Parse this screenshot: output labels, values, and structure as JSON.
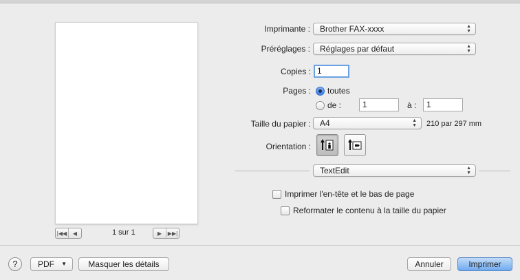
{
  "printer": {
    "label": "Imprimante :",
    "value": "Brother FAX-xxxx"
  },
  "presets": {
    "label": "Préréglages :",
    "value": "Réglages par défaut"
  },
  "copies": {
    "label": "Copies :",
    "value": "1"
  },
  "pages": {
    "label": "Pages :",
    "all_label": "toutes",
    "all_selected": true,
    "from_label": "de :",
    "from_value": "1",
    "to_label": "à :",
    "to_value": "1"
  },
  "paper_size": {
    "label": "Taille du papier :",
    "value": "A4",
    "dimensions": "210 par 297 mm"
  },
  "orientation": {
    "label": "Orientation :",
    "selected": "portrait",
    "icons": [
      "portrait-orientation-icon",
      "landscape-orientation-icon"
    ]
  },
  "app_section": {
    "value": "TextEdit"
  },
  "options": [
    {
      "label": "Imprimer l'en-tête et le bas de page",
      "checked": false
    },
    {
      "label": "Reformater le contenu à la taille du papier",
      "checked": false
    }
  ],
  "preview": {
    "page_counter": "1 sur 1"
  },
  "bottom": {
    "help_label": "?",
    "pdf_label": "PDF",
    "hide_details_label": "Masquer les détails",
    "cancel_label": "Annuler",
    "print_label": "Imprimer"
  },
  "colors": {
    "accent": "#3a7ee8",
    "default_button": "#70aaf0",
    "background": "#ececec"
  }
}
